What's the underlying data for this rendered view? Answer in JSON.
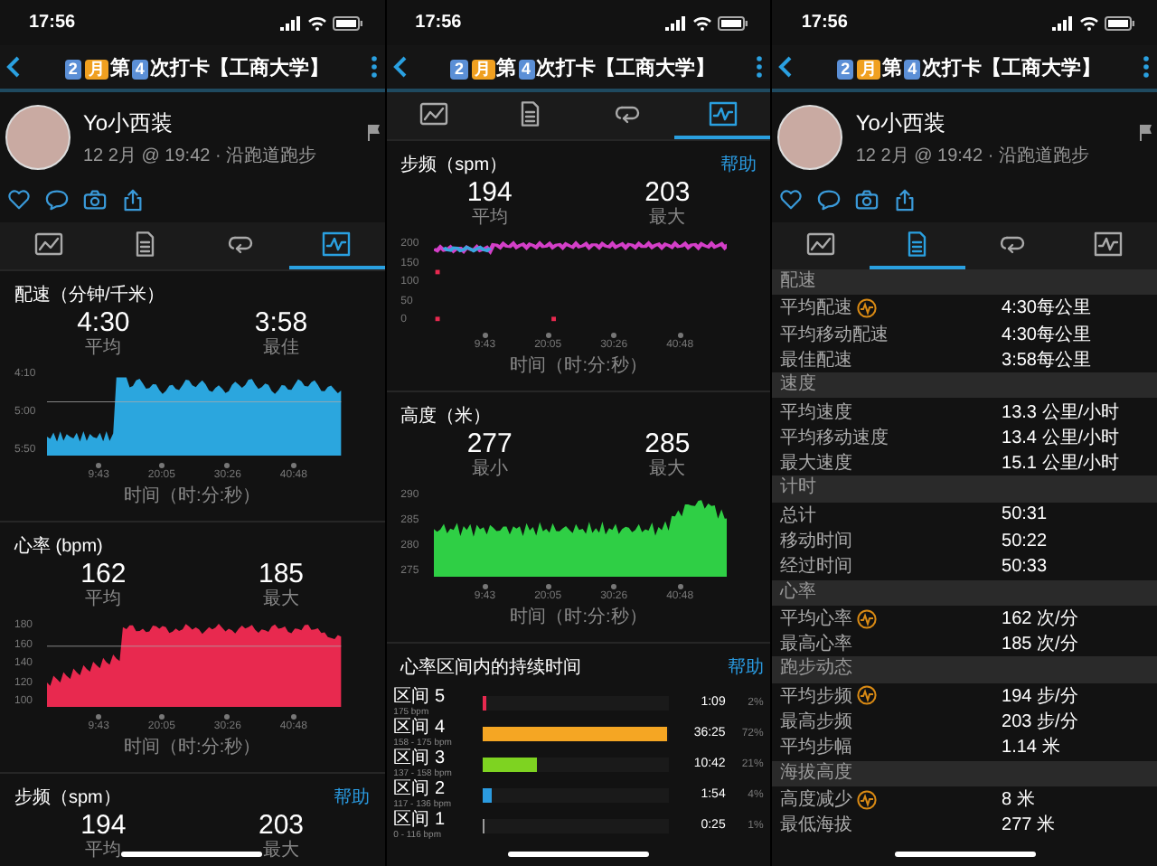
{
  "screens": [
    {
      "status_time": "17:56",
      "title": [
        {
          "text": "2",
          "kind": "key"
        },
        {
          "text": "月",
          "kind": "tile"
        },
        {
          "text": "第",
          "kind": "plain"
        },
        {
          "text": "4",
          "kind": "key"
        },
        {
          "text": "次打卡【工商大学】",
          "kind": "plain"
        }
      ],
      "profile": {
        "name": "Yo小西装",
        "meta": "12 2月 @ 19:42 · 沿跑道跑步"
      },
      "tabs": [
        {
          "kind": "image",
          "selected": false
        },
        {
          "kind": "document",
          "selected": false
        },
        {
          "kind": "loop",
          "selected": false
        },
        {
          "kind": "chart",
          "selected": true
        }
      ],
      "sections": [
        {
          "kind": "pace",
          "title": "配速（分钟/千米）",
          "stats": [
            {
              "value": "4:30",
              "label": "平均"
            },
            {
              "value": "3:58",
              "label": "最佳"
            }
          ],
          "y_labels": [
            "4:10",
            "5:00",
            "5:50"
          ],
          "x_labels": [
            "9:43",
            "20:05",
            "30:26",
            "40:48"
          ],
          "x_title": "时间（时:分:秒）"
        },
        {
          "kind": "heart_rate",
          "title": "心率 (bpm)",
          "stats": [
            {
              "value": "162",
              "label": "平均"
            },
            {
              "value": "185",
              "label": "最大"
            }
          ],
          "y_labels": [
            "180",
            "160",
            "140",
            "120",
            "100"
          ],
          "x_labels": [
            "9:43",
            "20:05",
            "30:26",
            "40:48"
          ],
          "x_title": "时间（时:分:秒）"
        },
        {
          "kind": "cadence",
          "title": "步频（spm）",
          "help": "帮助",
          "stats": [
            {
              "value": "194",
              "label": "平均"
            },
            {
              "value": "203",
              "label": "最大"
            }
          ]
        }
      ]
    },
    {
      "status_time": "17:56",
      "title": [
        {
          "text": "2",
          "kind": "key"
        },
        {
          "text": "月",
          "kind": "tile"
        },
        {
          "text": "第",
          "kind": "plain"
        },
        {
          "text": "4",
          "kind": "key"
        },
        {
          "text": "次打卡【工商大学】",
          "kind": "plain"
        }
      ],
      "tabs": [
        {
          "kind": "image",
          "selected": false
        },
        {
          "kind": "document",
          "selected": false
        },
        {
          "kind": "loop",
          "selected": false
        },
        {
          "kind": "chart",
          "selected": true
        }
      ],
      "sections": [
        {
          "kind": "cadence",
          "title": "步频（spm）",
          "help": "帮助",
          "stats": [
            {
              "value": "194",
              "label": "平均"
            },
            {
              "value": "203",
              "label": "最大"
            }
          ],
          "y_labels": [
            "200",
            "150",
            "100",
            "50",
            "0"
          ],
          "x_labels": [
            "9:43",
            "20:05",
            "30:26",
            "40:48"
          ],
          "x_title": "时间（时:分:秒）"
        },
        {
          "kind": "elevation",
          "title": "高度（米）",
          "stats": [
            {
              "value": "277",
              "label": "最小"
            },
            {
              "value": "285",
              "label": "最大"
            }
          ],
          "y_labels": [
            "290",
            "285",
            "280",
            "275"
          ],
          "x_labels": [
            "9:43",
            "20:05",
            "30:26",
            "40:48"
          ],
          "x_title": "时间（时:分:秒）"
        },
        {
          "kind": "zones",
          "title": "心率区间内的持续时间",
          "help": "帮助",
          "zones": [
            {
              "name": "区间 5",
              "range": "175 bpm",
              "time": "1:09",
              "percent": "2%",
              "level": 0.02,
              "color": "#e8294f"
            },
            {
              "name": "区间 4",
              "range": "158 - 175 bpm",
              "time": "36:25",
              "percent": "72%",
              "level": 0.99,
              "color": "#f5a623"
            },
            {
              "name": "区间 3",
              "range": "137 - 158 bpm",
              "time": "10:42",
              "percent": "21%",
              "level": 0.29,
              "color": "#7ed321"
            },
            {
              "name": "区间 2",
              "range": "117 - 136 bpm",
              "time": "1:54",
              "percent": "4%",
              "level": 0.05,
              "color": "#2b9be0"
            },
            {
              "name": "区间 1",
              "range": "0 - 116 bpm",
              "time": "0:25",
              "percent": "1%",
              "level": 0.01,
              "color": "#9b9b9b"
            }
          ]
        }
      ]
    },
    {
      "status_time": "17:56",
      "title": [
        {
          "text": "2",
          "kind": "key"
        },
        {
          "text": "月",
          "kind": "tile"
        },
        {
          "text": "第",
          "kind": "plain"
        },
        {
          "text": "4",
          "kind": "key"
        },
        {
          "text": "次打卡【工商大学】",
          "kind": "plain"
        }
      ],
      "profile": {
        "name": "Yo小西装",
        "meta": "12 2月 @ 19:42 · 沿跑道跑步"
      },
      "tabs": [
        {
          "kind": "image",
          "selected": false
        },
        {
          "kind": "document",
          "selected": true
        },
        {
          "kind": "loop",
          "selected": false
        },
        {
          "kind": "chart",
          "selected": false
        }
      ],
      "stats_groups": [
        {
          "title": "配速",
          "rows": [
            {
              "label": "平均配速",
              "value": "4:30每公里",
              "badge": true
            },
            {
              "label": "平均移动配速",
              "value": "4:30每公里",
              "badge": false
            },
            {
              "label": "最佳配速",
              "value": "3:58每公里",
              "badge": false
            }
          ]
        },
        {
          "title": "速度",
          "rows": [
            {
              "label": "平均速度",
              "value": "13.3 公里/小时",
              "badge": false
            },
            {
              "label": "平均移动速度",
              "value": "13.4 公里/小时",
              "badge": false
            },
            {
              "label": "最大速度",
              "value": "15.1 公里/小时",
              "badge": false
            }
          ]
        },
        {
          "title": "计时",
          "rows": [
            {
              "label": "总计",
              "value": "50:31",
              "badge": false
            },
            {
              "label": "移动时间",
              "value": "50:22",
              "badge": false
            },
            {
              "label": "经过时间",
              "value": "50:33",
              "badge": false
            }
          ]
        },
        {
          "title": "心率",
          "rows": [
            {
              "label": "平均心率",
              "value": "162 次/分",
              "badge": true
            },
            {
              "label": "最高心率",
              "value": "185 次/分",
              "badge": false
            }
          ]
        },
        {
          "title": "跑步动态",
          "rows": [
            {
              "label": "平均步频",
              "value": "194 步/分",
              "badge": true
            },
            {
              "label": "最高步频",
              "value": "203 步/分",
              "badge": false
            },
            {
              "label": "平均步幅",
              "value": "1.14 米",
              "badge": false
            }
          ]
        },
        {
          "title": "海拔高度",
          "rows": [
            {
              "label": "高度减少",
              "value": "8 米",
              "badge": true
            },
            {
              "label": "最低海拔",
              "value": "277 米",
              "badge": false
            }
          ]
        }
      ]
    }
  ]
}
